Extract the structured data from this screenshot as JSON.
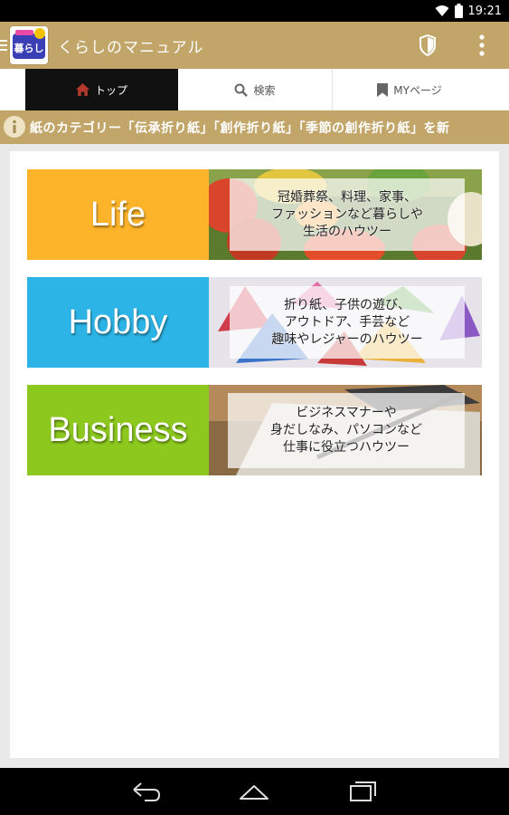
{
  "status_bar": {
    "time": "19:21"
  },
  "action_bar": {
    "app_icon_text": "暮らし",
    "title": "くらしのマニュアル"
  },
  "tabs": [
    {
      "label": "トップ",
      "icon": "home-icon",
      "active": true
    },
    {
      "label": "検索",
      "icon": "search-icon",
      "active": false
    },
    {
      "label": "MYページ",
      "icon": "bookmark-icon",
      "active": false
    }
  ],
  "ticker": {
    "icon": "info-icon",
    "text": "紙のカテゴリー「伝承折り紙」「創作折り紙」「季節の創作折り紙」を新"
  },
  "banners": [
    {
      "label": "Life",
      "color": "#fdb32a",
      "description": "冠婚葬祭、料理、家事、\nファッションなど暮らしや\n生活のハウツー"
    },
    {
      "label": "Hobby",
      "color": "#2cb4e6",
      "description": "折り紙、子供の遊び、\nアウトドア、手芸など\n趣味やレジャーのハウツー"
    },
    {
      "label": "Business",
      "color": "#8cc81e",
      "description": "ビジネスマナーや\n身だしなみ、パソコンなど\n仕事に役立つハウツー"
    }
  ],
  "colors": {
    "accent": "#c2a568",
    "tab_active_bg": "#111111",
    "background": "#e9e9e9"
  },
  "nav_bar": {
    "icons": [
      "back-icon",
      "home-nav-icon",
      "recent-apps-icon"
    ]
  }
}
